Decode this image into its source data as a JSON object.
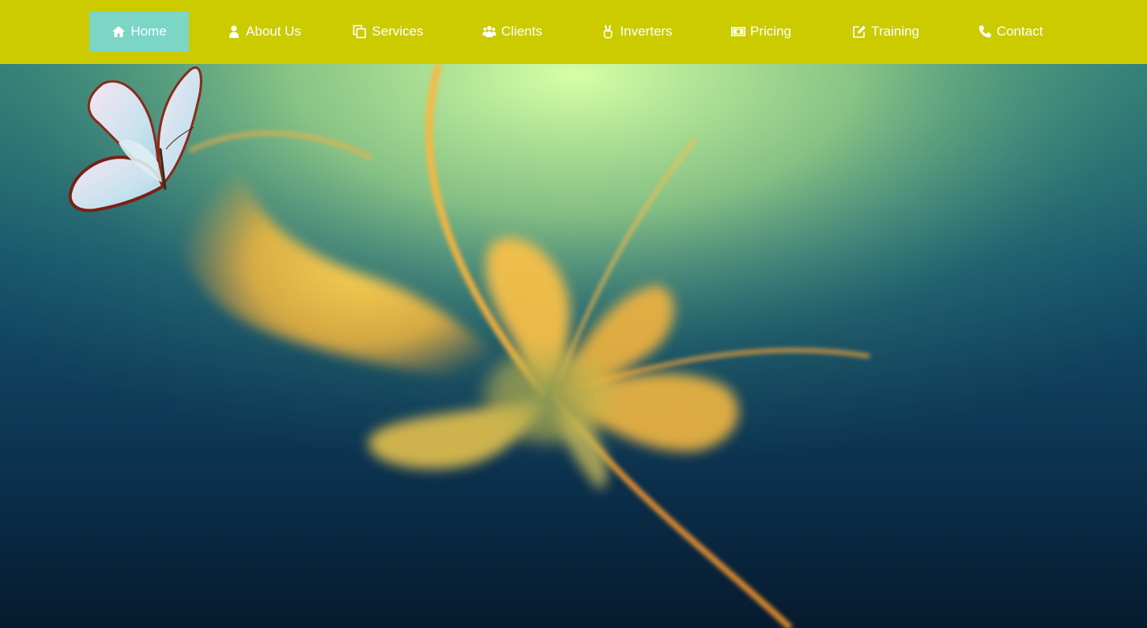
{
  "nav": {
    "items": [
      {
        "label": "Home",
        "icon": "home-icon",
        "active": true
      },
      {
        "label": "About Us",
        "icon": "user-icon",
        "active": false
      },
      {
        "label": "Services",
        "icon": "copy-icon",
        "active": false
      },
      {
        "label": "Clients",
        "icon": "users-icon",
        "active": false
      },
      {
        "label": "Inverters",
        "icon": "victory-hand-icon",
        "active": false
      },
      {
        "label": "Pricing",
        "icon": "money-icon",
        "active": false
      },
      {
        "label": "Training",
        "icon": "edit-icon",
        "active": false
      },
      {
        "label": "Contact",
        "icon": "phone-icon",
        "active": false
      }
    ]
  },
  "colors": {
    "navbar": "#cbcb00",
    "active_tab": "#7bd6c6",
    "nav_text": "#ffffff"
  }
}
